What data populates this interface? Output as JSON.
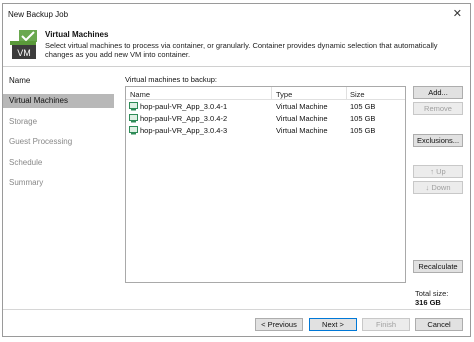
{
  "window": {
    "title": "New Backup Job",
    "close_glyph": "✕"
  },
  "header": {
    "title": "Virtual Machines",
    "description": "Select virtual machines to process via container, or granularly. Container provides dynamic selection that automatically changes as you add new VM into container.",
    "icon_text": "VM"
  },
  "sidebar": {
    "items": [
      {
        "label": "Name"
      },
      {
        "label": "Virtual Machines"
      },
      {
        "label": "Storage"
      },
      {
        "label": "Guest Processing"
      },
      {
        "label": "Schedule"
      },
      {
        "label": "Summary"
      }
    ]
  },
  "content": {
    "list_label": "Virtual machines to backup:",
    "columns": {
      "name": "Name",
      "type": "Type",
      "size": "Size"
    },
    "rows": [
      {
        "name": "hop-paul-VR_App_3.0.4-1",
        "type": "Virtual Machine",
        "size": "105 GB"
      },
      {
        "name": "hop-paul-VR_App_3.0.4-2",
        "type": "Virtual Machine",
        "size": "105 GB"
      },
      {
        "name": "hop-paul-VR_App_3.0.4-3",
        "type": "Virtual Machine",
        "size": "105 GB"
      }
    ]
  },
  "side_buttons": {
    "add": "Add...",
    "remove": "Remove",
    "exclusions": "Exclusions...",
    "up": "Up",
    "down": "Down",
    "recalculate": "Recalculate"
  },
  "total": {
    "label": "Total size:",
    "value": "316 GB"
  },
  "footer": {
    "previous": "< Previous",
    "next": "Next >",
    "finish": "Finish",
    "cancel": "Cancel"
  },
  "colors": {
    "active_sidebar": "#b8b8b8",
    "accent": "#0078d7",
    "vm_icon": "#2e8b57"
  }
}
